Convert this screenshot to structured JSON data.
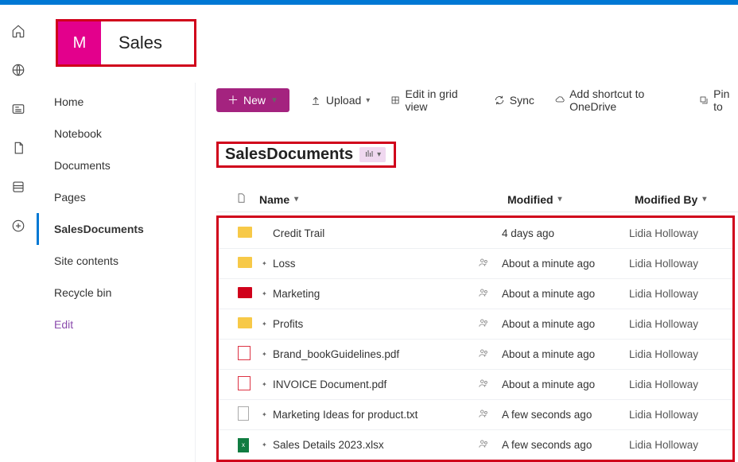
{
  "site": {
    "logo_letter": "M",
    "title": "Sales"
  },
  "rail": {
    "icons": [
      "home-icon",
      "globe-icon",
      "news-icon",
      "file-icon",
      "db-icon",
      "add-icon"
    ]
  },
  "leftnav": {
    "items": [
      {
        "label": "Home",
        "active": false
      },
      {
        "label": "Notebook",
        "active": false
      },
      {
        "label": "Documents",
        "active": false
      },
      {
        "label": "Pages",
        "active": false
      },
      {
        "label": "SalesDocuments",
        "active": true
      },
      {
        "label": "Site contents",
        "active": false
      },
      {
        "label": "Recycle bin",
        "active": false
      }
    ],
    "edit_label": "Edit"
  },
  "toolbar": {
    "new_label": "New",
    "upload_label": "Upload",
    "grid_label": "Edit in grid view",
    "sync_label": "Sync",
    "shortcut_label": "Add shortcut to OneDrive",
    "pin_label": "Pin to"
  },
  "library": {
    "title": "SalesDocuments"
  },
  "columns": {
    "type": "",
    "name": "Name",
    "modified": "Modified",
    "by": "Modified By"
  },
  "files": [
    {
      "icon": "folder-yellow",
      "new": false,
      "name": "Credit Trail",
      "shared": false,
      "modified": "4 days ago",
      "by": "Lidia Holloway"
    },
    {
      "icon": "folder-yellow",
      "new": true,
      "name": "Loss",
      "shared": true,
      "modified": "About a minute ago",
      "by": "Lidia Holloway"
    },
    {
      "icon": "folder-red",
      "new": true,
      "name": "Marketing",
      "shared": true,
      "modified": "About a minute ago",
      "by": "Lidia Holloway"
    },
    {
      "icon": "folder-yellow",
      "new": true,
      "name": "Profits",
      "shared": true,
      "modified": "About a minute ago",
      "by": "Lidia Holloway"
    },
    {
      "icon": "file-pdf",
      "new": true,
      "name": "Brand_bookGuidelines.pdf",
      "shared": true,
      "modified": "About a minute ago",
      "by": "Lidia Holloway"
    },
    {
      "icon": "file-pdf",
      "new": true,
      "name": "INVOICE Document.pdf",
      "shared": true,
      "modified": "About a minute ago",
      "by": "Lidia Holloway"
    },
    {
      "icon": "file-txt",
      "new": true,
      "name": "Marketing Ideas for product.txt",
      "shared": true,
      "modified": "A few seconds ago",
      "by": "Lidia Holloway"
    },
    {
      "icon": "file-xlsx",
      "new": true,
      "name": "Sales Details 2023.xlsx",
      "shared": true,
      "modified": "A few seconds ago",
      "by": "Lidia Holloway"
    }
  ]
}
